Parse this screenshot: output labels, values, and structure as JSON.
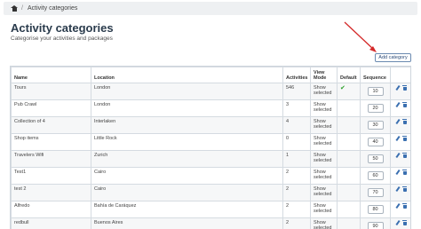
{
  "breadcrumb": {
    "separator": "/",
    "current": "Activity categories"
  },
  "page": {
    "title": "Activity categories",
    "subtitle": "Categorise your activities and packages",
    "add_button": "Add category"
  },
  "table": {
    "headers": {
      "name": "Name",
      "location": "Location",
      "activities": "Activities",
      "view_mode": "View Mode",
      "default": "Default",
      "sequence": "Sequence"
    },
    "rows": [
      {
        "name": "Tours",
        "location": "London",
        "activities": "546",
        "view_mode": "Show selected",
        "default": true,
        "sequence": "10"
      },
      {
        "name": "Pub Crawl",
        "location": "London",
        "activities": "3",
        "view_mode": "Show selected",
        "default": false,
        "sequence": "20"
      },
      {
        "name": "Collection of 4",
        "location": "Interlaken",
        "activities": "4",
        "view_mode": "Show selected",
        "default": false,
        "sequence": "30"
      },
      {
        "name": "Shop items",
        "location": "Little Rock",
        "activities": "0",
        "view_mode": "Show selected",
        "default": false,
        "sequence": "40"
      },
      {
        "name": "Travelers Wifi",
        "location": "Zurich",
        "activities": "1",
        "view_mode": "Show selected",
        "default": false,
        "sequence": "50"
      },
      {
        "name": "Test1",
        "location": "Cairo",
        "activities": "2",
        "view_mode": "Show selected",
        "default": false,
        "sequence": "60"
      },
      {
        "name": "test 2",
        "location": "Cairo",
        "activities": "2",
        "view_mode": "Show selected",
        "default": false,
        "sequence": "70"
      },
      {
        "name": "Alfredo",
        "location": "Bahía de Caráquez",
        "activities": "2",
        "view_mode": "Show selected",
        "default": false,
        "sequence": "80"
      },
      {
        "name": "redbull",
        "location": "Buenos Aires",
        "activities": "2",
        "view_mode": "Show selected",
        "default": false,
        "sequence": "90"
      }
    ]
  },
  "icons": {
    "home": "home-icon",
    "edit": "pencil-icon",
    "delete": "trash-icon",
    "check": "checkmark-icon"
  },
  "colors": {
    "accent": "#2a4a78",
    "check": "#2aa02a",
    "icon": "#3a6fb0",
    "arrow": "#d42a2a"
  }
}
